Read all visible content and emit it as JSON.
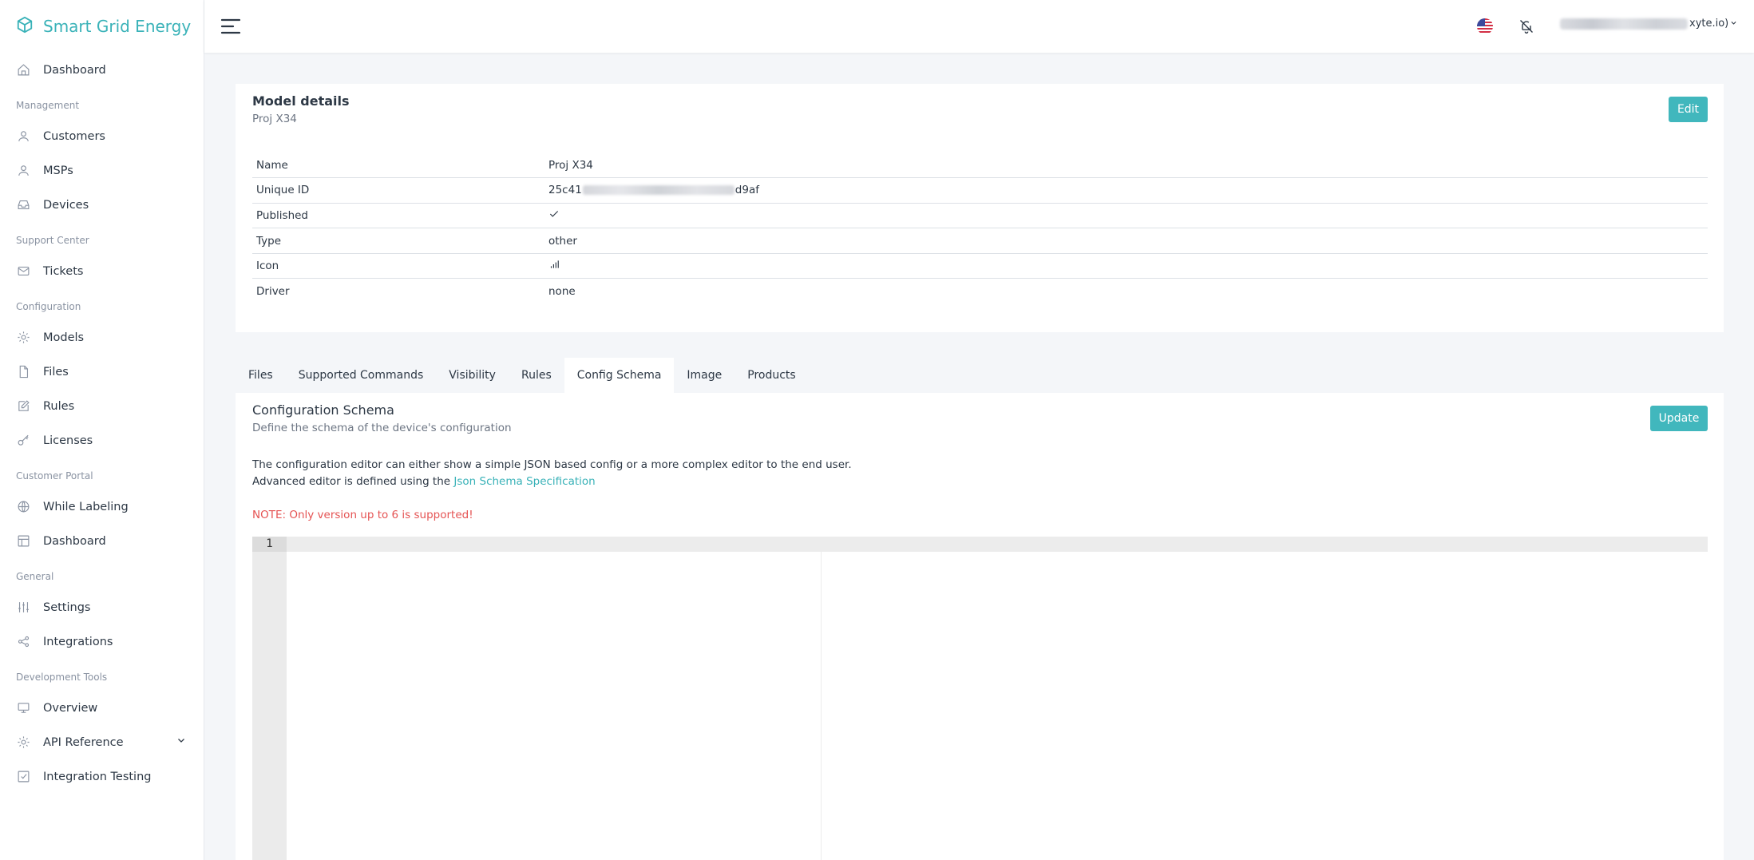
{
  "brand": {
    "name": "Smart Grid Energy"
  },
  "sidebar": {
    "dashboard": "Dashboard",
    "sections": [
      {
        "title": "Management",
        "items": [
          {
            "label": "Customers"
          },
          {
            "label": "MSPs"
          },
          {
            "label": "Devices"
          }
        ]
      },
      {
        "title": "Support Center",
        "items": [
          {
            "label": "Tickets"
          }
        ]
      },
      {
        "title": "Configuration",
        "items": [
          {
            "label": "Models"
          },
          {
            "label": "Files"
          },
          {
            "label": "Rules"
          },
          {
            "label": "Licenses"
          }
        ]
      },
      {
        "title": "Customer Portal",
        "items": [
          {
            "label": "While Labeling"
          },
          {
            "label": "Dashboard"
          }
        ]
      },
      {
        "title": "General",
        "items": [
          {
            "label": "Settings"
          },
          {
            "label": "Integrations"
          }
        ]
      },
      {
        "title": "Development Tools",
        "items": [
          {
            "label": "Overview"
          },
          {
            "label": "API Reference"
          },
          {
            "label": "Integration Testing"
          }
        ]
      }
    ]
  },
  "header": {
    "user_suffix": "xyte.io)"
  },
  "model": {
    "title": "Model details",
    "subtitle": "Proj X34",
    "edit_label": "Edit",
    "rows": [
      {
        "key": "Name",
        "value": "Proj X34"
      },
      {
        "key": "Unique ID",
        "value_prefix": "25c41",
        "value_suffix": "d9af"
      },
      {
        "key": "Published",
        "value": ""
      },
      {
        "key": "Type",
        "value": "other"
      },
      {
        "key": "Icon",
        "value": ""
      },
      {
        "key": "Driver",
        "value": "none"
      }
    ]
  },
  "tabs": [
    {
      "label": "Files"
    },
    {
      "label": "Supported Commands"
    },
    {
      "label": "Visibility"
    },
    {
      "label": "Rules"
    },
    {
      "label": "Config Schema",
      "active": true
    },
    {
      "label": "Image"
    },
    {
      "label": "Products"
    }
  ],
  "config": {
    "title": "Configuration Schema",
    "subtitle": "Define the schema of the device's configuration",
    "update_label": "Update",
    "desc_line1": "The configuration editor can either show a simple JSON based config or a more complex editor to the end user.",
    "desc_line2_prefix": "Advanced editor is defined using the ",
    "desc_link": "Json Schema Specification",
    "note": "NOTE: Only version up to 6 is supported!",
    "editor_line_number": "1"
  },
  "colors": {
    "accent": "#39b2b8",
    "button": "#41b7bd",
    "danger": "#e55353",
    "background": "#f4f6f9"
  }
}
